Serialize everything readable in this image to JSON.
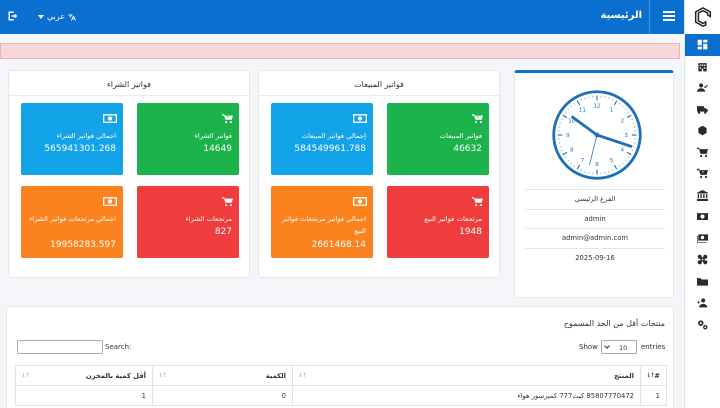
{
  "nav": {
    "title": "الرئيسية",
    "language": "عربي"
  },
  "sales_card": {
    "title": "فواتير المبيعات",
    "tiles": [
      {
        "label": "فواتير المبيعات",
        "value": "46632",
        "icon": "cart-arrow-icon"
      },
      {
        "label": "إجمالي فواتير المبيعات",
        "value": "584549961.788",
        "icon": "money-icon"
      },
      {
        "label": "مرتجعات فواتير البيع",
        "value": "1948",
        "icon": "cart-icon"
      },
      {
        "label": "اجمالي فواتير مرتجعات فواتير البيع",
        "value": "2661468.14",
        "icon": "money-icon"
      }
    ]
  },
  "purchase_card": {
    "title": "فواتير الشراء",
    "tiles": [
      {
        "label": "فواتير الشراء",
        "value": "14649",
        "icon": "cart-arrow-icon"
      },
      {
        "label": "اجمالي فواتير الشراء",
        "value": "565941301.268",
        "icon": "money-icon"
      },
      {
        "label": "مرتجعات الشراء",
        "value": "827",
        "icon": "cart-icon"
      },
      {
        "label": "اجمالي مرتجعات فواتير الشراء",
        "value": "19958283.597",
        "icon": "money-icon"
      }
    ]
  },
  "profile": {
    "branch": "الفرع الرئيسي",
    "username": "admin",
    "email": "admin@admin.com",
    "date": "2025-09-16"
  },
  "table_card": {
    "title": "منتجات أقل من الحد المسموح",
    "search_label": "Search:",
    "show_label": "Show",
    "entries_value": "10",
    "entries_label": "entries",
    "columns": [
      "#",
      "المنتج",
      "الكمية",
      "أقل كمية بالمخزن"
    ],
    "rows": [
      [
        "1",
        "85807770472 كيت777 كمبرسور هواء",
        "0",
        "1"
      ]
    ]
  },
  "colors": {
    "primary": "#0b6fd0",
    "green": "#1db34c",
    "blue": "#12a3e8",
    "red": "#ef3d3d",
    "orange": "#fb821e"
  }
}
